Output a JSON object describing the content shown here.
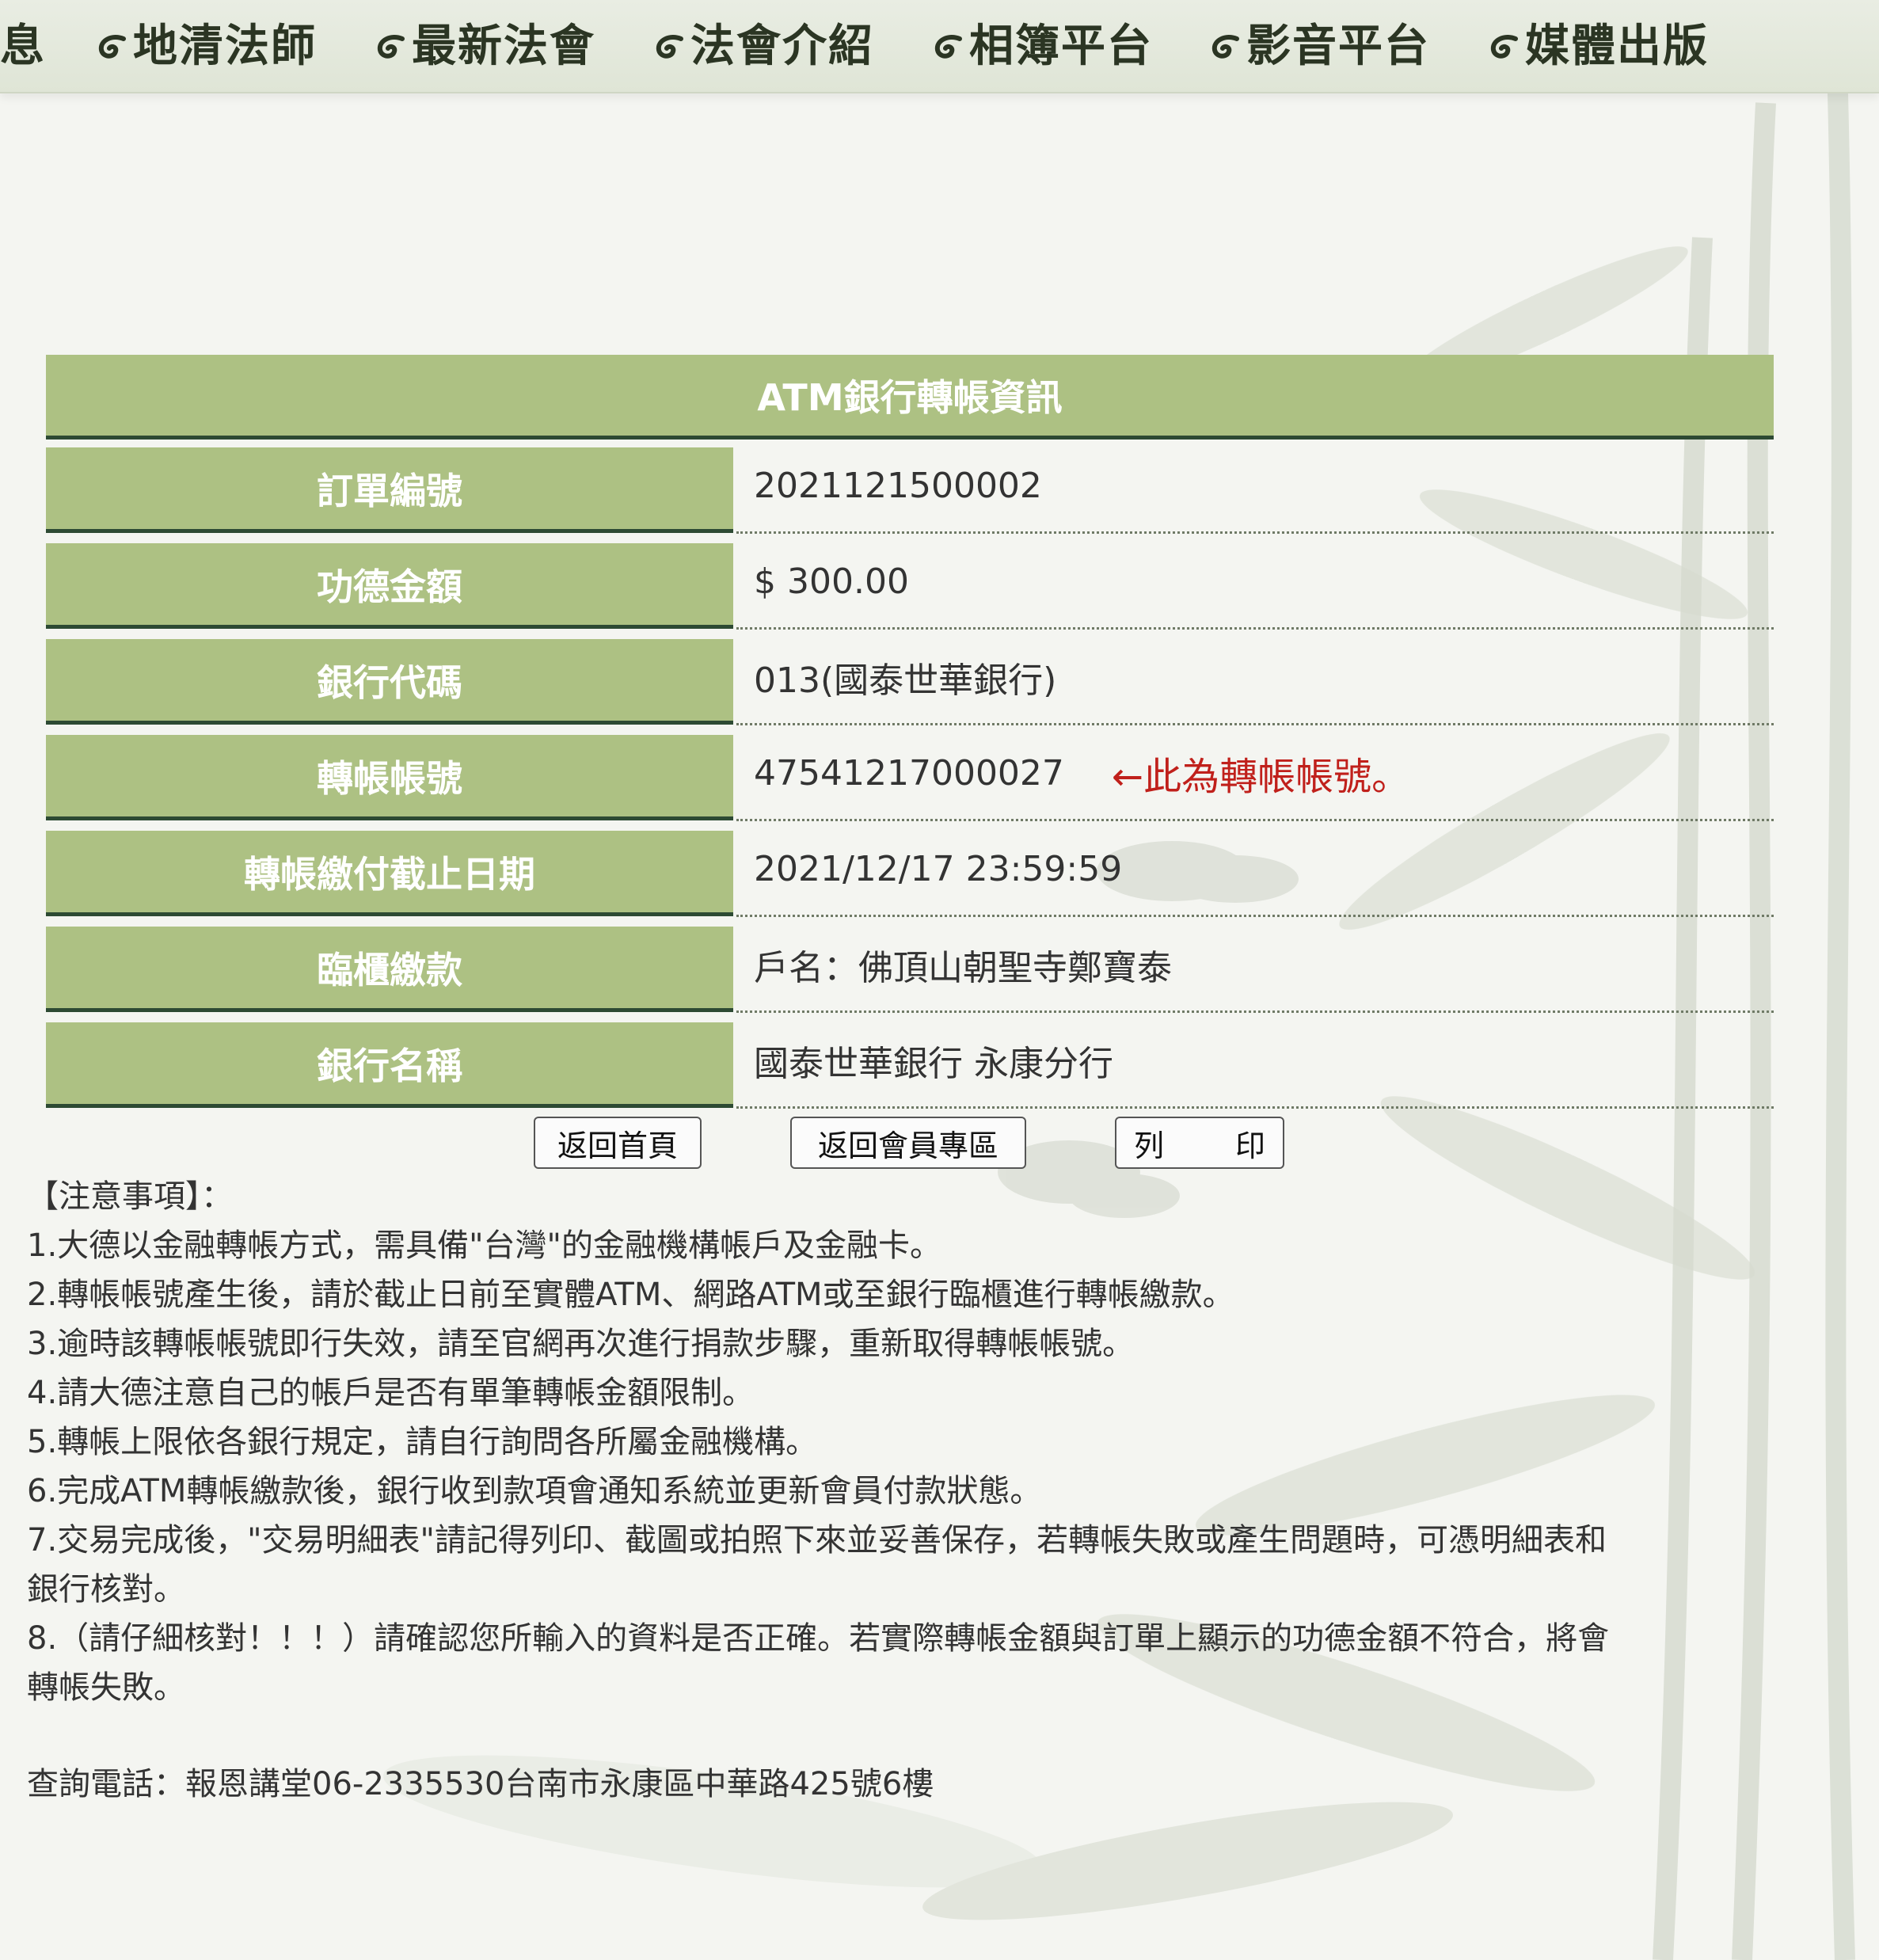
{
  "nav": {
    "items": [
      "息",
      "地清法師",
      "最新法會",
      "法會介紹",
      "相簿平台",
      "影音平台",
      "媒體出版"
    ]
  },
  "table": {
    "title": "ATM銀行轉帳資訊",
    "rows": [
      {
        "label": "訂單編號",
        "value": "2021121500002"
      },
      {
        "label": "功德金額",
        "value": "$ 300.00"
      },
      {
        "label": "銀行代碼",
        "value": "013(國泰世華銀行)"
      },
      {
        "label": "轉帳帳號",
        "value": "47541217000027",
        "note": "←此為轉帳帳號。"
      },
      {
        "label": "轉帳繳付截止日期",
        "value": "2021/12/17 23:59:59"
      },
      {
        "label": "臨櫃繳款",
        "value": "戶名：佛頂山朝聖寺鄭寶泰"
      },
      {
        "label": "銀行名稱",
        "value": "國泰世華銀行 永康分行"
      }
    ]
  },
  "buttons": {
    "home": "返回首頁",
    "member": "返回會員專區",
    "print_1": "列",
    "print_2": "印"
  },
  "notes": {
    "heading": "【注意事項】：",
    "lines": [
      "1.大德以金融轉帳方式，需具備\"台灣\"的金融機構帳戶及金融卡。",
      "2.轉帳帳號產生後，請於截止日前至實體ATM、網路ATM或至銀行臨櫃進行轉帳繳款。",
      "3.逾時該轉帳帳號即行失效，請至官網再次進行捐款步驟，重新取得轉帳帳號。",
      "4.請大德注意自己的帳戶是否有單筆轉帳金額限制。",
      "5.轉帳上限依各銀行規定，請自行詢問各所屬金融機構。",
      "6.完成ATM轉帳繳款後，銀行收到款項會通知系統並更新會員付款狀態。",
      "7.交易完成後，\"交易明細表\"請記得列印、截圖或拍照下來並妥善保存，若轉帳失敗或產生問題時，可憑明細表和",
      "銀行核對。",
      "8.（請仔細核對！！！）請確認您所輸入的資料是否正確。若實際轉帳金額與訂單上顯示的功德金額不符合，將會",
      "轉帳失敗。"
    ]
  },
  "contact": "查詢電話：報恩講堂06-2335530台南市永康區中華路425號6樓",
  "colors": {
    "header_green": "#adc183",
    "border_dark_green": "#2d4a33",
    "note_red": "#c0201b",
    "background": "#f4f5f1"
  }
}
